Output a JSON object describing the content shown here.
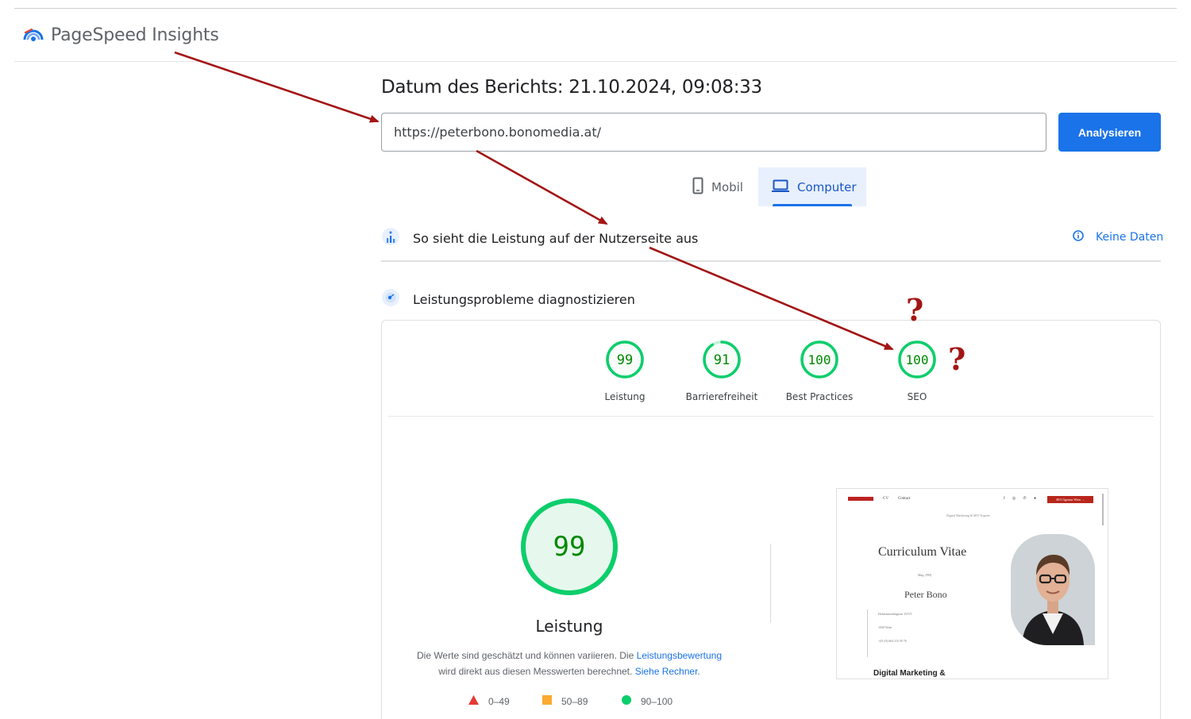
{
  "app": {
    "title": "PageSpeed Insights"
  },
  "report": {
    "date_label": "Datum des Berichts: 21.10.2024, 09:08:33"
  },
  "search": {
    "url": "https://peterbono.bonomedia.at/",
    "analyze_label": "Analysieren"
  },
  "device_tabs": [
    {
      "label": "Mobil",
      "icon": "phone-icon",
      "selected": false
    },
    {
      "label": "Computer",
      "icon": "laptop-icon",
      "selected": true
    }
  ],
  "field_data": {
    "title": "So sieht die Leistung auf der Nutzerseite aus",
    "status": "Keine Daten"
  },
  "diagnose": {
    "title": "Leistungsprobleme diagnostizieren"
  },
  "scores": [
    {
      "label": "Leistung",
      "value": 99
    },
    {
      "label": "Barrierefreiheit",
      "value": 91
    },
    {
      "label": "Best Practices",
      "value": 100
    },
    {
      "label": "SEO",
      "value": 100
    }
  ],
  "performance": {
    "score": 99,
    "title": "Leistung",
    "desc_1": "Die Werte sind geschätzt und können variieren. Die ",
    "link_1": "Leistungsbewertung",
    "desc_2": "wird direkt aus diesen Messwerten berechnet. ",
    "link_2": "Siehe Rechner",
    "desc_3": "."
  },
  "legend": [
    {
      "range": "0–49",
      "color": "#e53935",
      "shape": "triangle"
    },
    {
      "range": "50–89",
      "color": "#fbaa32",
      "shape": "square"
    },
    {
      "range": "90–100",
      "color": "#0cce6b",
      "shape": "circle"
    }
  ],
  "page_preview": {
    "nav_cv": "CV",
    "nav_contact": "Contact",
    "cta": "SEO Agentur Wien →",
    "tagline": "Digital Marketing & SEO Experte",
    "heading": "Curriculum Vitae",
    "degree": "Mag. (FH)",
    "name": "Peter Bono",
    "address_1": "Hofmannsthalgasse 10/5/5",
    "address_2": "1030 Wien",
    "phone": "+43 (0) 664 116 59 76",
    "footer_heading": "Digital Marketing &"
  },
  "annotations": {
    "question_mark": "?"
  },
  "colors": {
    "accent": "#1a73e8",
    "pass": "#0cce6b",
    "pass_text": "#008800",
    "annotation": "#a31515"
  }
}
